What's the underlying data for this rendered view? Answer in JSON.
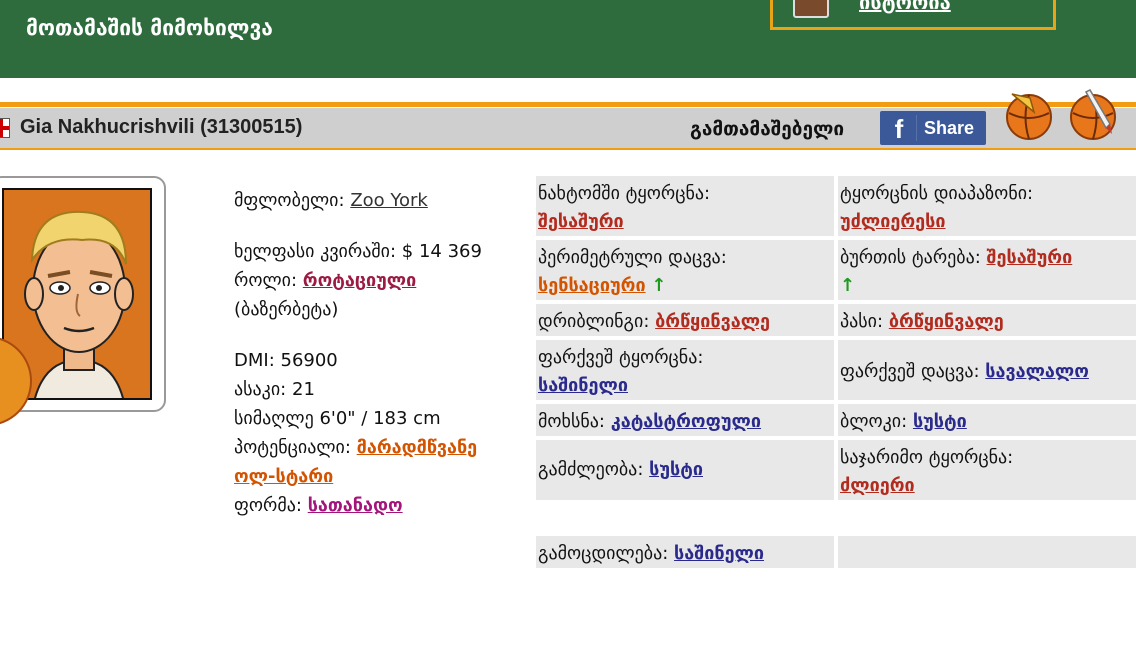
{
  "header": {
    "title": "მოთამაშის მიმოხილვა",
    "history_link": "ისტორია",
    "accent": "#f39c12",
    "bar_color": "#2e6b3d"
  },
  "player": {
    "name": "Gia Nakhucrishvili (31300515)",
    "players_label": "გამთამაშებელი",
    "share_label": "Share",
    "share_icon": "f"
  },
  "info": {
    "owner_label": "მფლობელი:",
    "owner_value": "Zoo York",
    "salary_label": "ხელფასი კვირაში:",
    "salary_value": "$ 14 369",
    "role_label": "როლი:",
    "role_value": "როტაციული",
    "role_note": "(ბაზერბეტა)",
    "dmi_label": "DMI:",
    "dmi_value": "56900",
    "age_label": "ასაკი:",
    "age_value": "21",
    "height_label": "სიმაღლე",
    "height_value": "6'0\" / 183 cm",
    "potential_label": "პოტენციალი:",
    "potential_value_1": "მარადმწვანე",
    "potential_value_2": "ოლ-სტარი",
    "form_label": "ფორმა:",
    "form_value": "სათანადო"
  },
  "skills": [
    {
      "label": "ნახტომში ტყორცნა:",
      "value": "შესაშური",
      "color": "red"
    },
    {
      "label": "ტყორცნის დიაპაზონი:",
      "value": "უძლიერესი",
      "color": "red"
    },
    {
      "label": "პერიმეტრული დაცვა:",
      "value": "სენსაციური",
      "color": "orange",
      "arrow": "↑"
    },
    {
      "label": "ბურთის ტარება:",
      "value": "შესაშური",
      "color": "red",
      "arrow": "↑"
    },
    {
      "label": "დრიბლინგი:",
      "value": "ბრწყინვალე",
      "color": "red"
    },
    {
      "label": "პასი:",
      "value": "ბრწყინვალე",
      "color": "red"
    },
    {
      "label": "ფარქვეშ ტყორცნა:",
      "value": "საშინელი",
      "color": "navy"
    },
    {
      "label": "ფარქვეშ დაცვა:",
      "value": "სავალალო",
      "color": "navy"
    },
    {
      "label": "მოხსნა:",
      "value": "კატასტროფული",
      "color": "navy"
    },
    {
      "label": "ბლოკი:",
      "value": "სუსტი",
      "color": "navy"
    },
    {
      "label": "გამძლეობა:",
      "value": "სუსტი",
      "color": "navy"
    },
    {
      "label": "საჯარიმო ტყორცნა:",
      "value": "ძლიერი",
      "color": "red"
    },
    {
      "label": "გამოცდილება:",
      "value": "საშინელი",
      "color": "navy"
    }
  ]
}
